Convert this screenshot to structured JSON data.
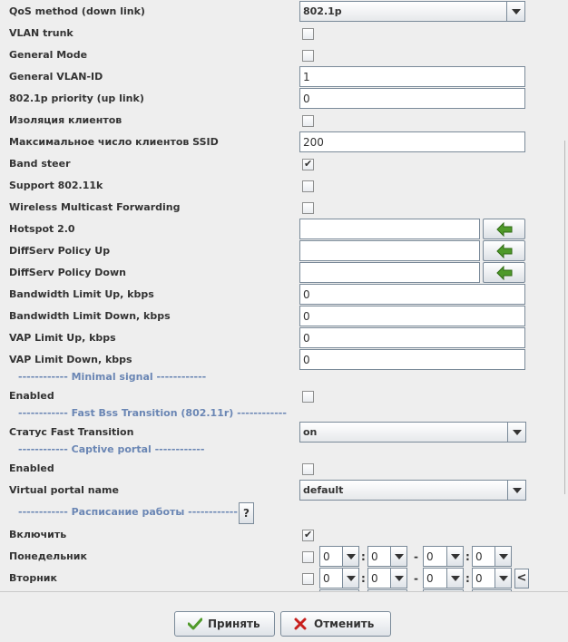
{
  "form": {
    "qos_method": {
      "label": "QoS method (down link)",
      "value": "802.1p"
    },
    "vlan_trunk": {
      "label": "VLAN trunk",
      "checked": false
    },
    "general_mode": {
      "label": "General Mode",
      "checked": false
    },
    "general_vlan_id": {
      "label": "General VLAN-ID",
      "value": "1"
    },
    "priority_up": {
      "label": "802.1p priority (up link)",
      "value": "0"
    },
    "client_isolation": {
      "label": "Изоляция клиентов",
      "checked": false
    },
    "max_clients": {
      "label": "Максимальное число клиентов SSID",
      "value": "200"
    },
    "band_steer": {
      "label": "Band steer",
      "checked": true
    },
    "support_80211k": {
      "label": "Support 802.11k",
      "checked": false
    },
    "wmf": {
      "label": "Wireless Multicast Forwarding",
      "checked": false
    },
    "hotspot": {
      "label": "Hotspot 2.0",
      "value": ""
    },
    "diffserv_up": {
      "label": "DiffServ Policy Up",
      "value": ""
    },
    "diffserv_down": {
      "label": "DiffServ Policy Down",
      "value": ""
    },
    "bw_up": {
      "label": "Bandwidth Limit Up, kbps",
      "value": "0"
    },
    "bw_down": {
      "label": "Bandwidth Limit Down, kbps",
      "value": "0"
    },
    "vap_up": {
      "label": "VAP Limit Up, kbps",
      "value": "0"
    },
    "vap_down": {
      "label": "VAP Limit Down, kbps",
      "value": "0"
    }
  },
  "minimal_signal": {
    "header": "------------ Minimal signal ------------",
    "enabled": {
      "label": "Enabled",
      "checked": false
    }
  },
  "fast_bss": {
    "header": "------------ Fast Bss Transition (802.11r) ------------",
    "status": {
      "label": "Статус Fast Transition",
      "value": "on"
    }
  },
  "captive_portal": {
    "header": "------------ Captive portal ------------",
    "enabled": {
      "label": "Enabled",
      "checked": false
    },
    "portal_name": {
      "label": "Virtual portal name",
      "value": "default"
    }
  },
  "schedule": {
    "header": "------------ Расписание работы ------------",
    "help_label": "?",
    "enable": {
      "label": "Включить",
      "checked": true
    },
    "days": [
      {
        "label": "Понедельник",
        "checked": false,
        "from_h": "0",
        "from_m": "0",
        "to_h": "0",
        "to_m": "0"
      },
      {
        "label": "Вторник",
        "checked": false,
        "from_h": "0",
        "from_m": "0",
        "to_h": "0",
        "to_m": "0"
      }
    ],
    "colon": ":",
    "dash": "-",
    "copy_label": "<"
  },
  "buttons": {
    "accept": "Принять",
    "cancel": "Отменить"
  },
  "colors": {
    "accent_green": "#4f9a2a",
    "cancel_red": "#c8201e",
    "section_blue": "#6a86b4"
  },
  "icons": {
    "arrow_left": "green-left-arrow-icon",
    "check": "green-check-icon",
    "cross": "red-x-icon"
  }
}
